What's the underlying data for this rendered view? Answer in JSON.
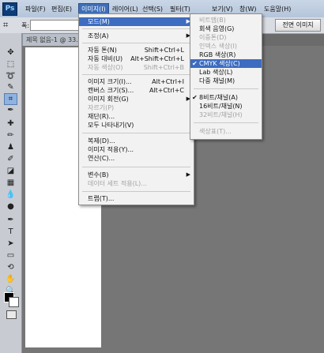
{
  "app": {
    "logo": "Ps"
  },
  "menubar": {
    "items": [
      "파일(F)",
      "편집(E)",
      "이미지(I)",
      "레이어(L)",
      "선택(S)",
      "필터(T)",
      "보기(V)",
      "창(W)",
      "도움말(H)"
    ]
  },
  "options_bar": {
    "width_label": "폭:",
    "front_image_button": "전면 이미지"
  },
  "document": {
    "tab_title": "제목 없음-1 @ 33.3"
  },
  "image_menu": {
    "mode": "모드(M)",
    "adjustments": "조정(A)",
    "auto_tone": {
      "label": "자동 톤(N)",
      "shortcut": "Shift+Ctrl+L"
    },
    "auto_contrast": {
      "label": "자동 대비(U)",
      "shortcut": "Alt+Shift+Ctrl+L"
    },
    "auto_color": {
      "label": "자동 색상(O)",
      "shortcut": "Shift+Ctrl+B"
    },
    "image_size": {
      "label": "이미지 크기(I)...",
      "shortcut": "Alt+Ctrl+I"
    },
    "canvas_size": {
      "label": "캔버스 크기(S)...",
      "shortcut": "Alt+Ctrl+C"
    },
    "image_rotation": "이미지 회전(G)",
    "crop": "자르기(P)",
    "trim": "재단(R)...",
    "reveal_all": "모두 나타내기(V)",
    "duplicate": "복제(D)...",
    "apply_image": "이미지 적용(Y)...",
    "calculations": "연산(C)...",
    "variables": "변수(B)",
    "apply_data_set": "데이터 세트 적용(L)...",
    "trap": "트랩(T)..."
  },
  "mode_menu": {
    "bitmap": "비트맵(B)",
    "grayscale": "회색 음영(G)",
    "duotone": "이중톤(D)",
    "indexed_color": "인덱스 색상(I)",
    "rgb_color": "RGB 색상(R)",
    "cmyk_color": "CMYK 색상(C)",
    "lab_color": "Lab 색상(L)",
    "multichannel": "다중 채널(M)",
    "bits8": "8비트/채널(A)",
    "bits16": "16비트/채널(N)",
    "bits32": "32비트/채널(H)",
    "color_table": "색상표(T)..."
  }
}
